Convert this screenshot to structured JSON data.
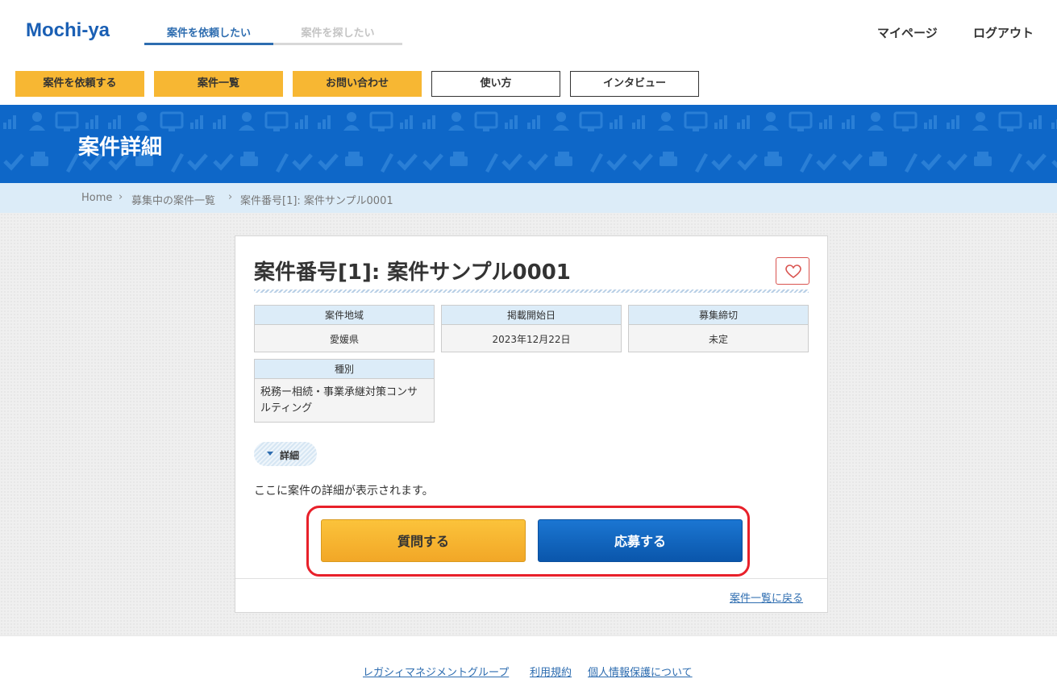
{
  "header": {
    "logo": "Mochi-ya",
    "mode_tabs": [
      {
        "label": "案件を依頼したい",
        "active": true
      },
      {
        "label": "案件を探したい",
        "active": false
      }
    ],
    "mypage": "マイページ",
    "logout": "ログアウト"
  },
  "subnav": [
    {
      "label": "案件を依頼する",
      "style": "yellow"
    },
    {
      "label": "案件一覧",
      "style": "yellow"
    },
    {
      "label": "お問い合わせ",
      "style": "yellow"
    },
    {
      "label": "使い方",
      "style": "outline"
    },
    {
      "label": "インタビュー",
      "style": "outline"
    }
  ],
  "banner": {
    "title": "案件詳細"
  },
  "breadcrumb": {
    "items": [
      "Home",
      "募集中の案件一覧",
      "案件番号[1]: 案件サンプル0001"
    ],
    "separator": "›"
  },
  "project": {
    "title": "案件番号[1]: 案件サンプル0001",
    "favorite_icon": "heart-icon",
    "fields": {
      "region": {
        "label": "案件地域",
        "value": "愛媛県"
      },
      "start_date": {
        "label": "掲載開始日",
        "value": "2023年12月22日"
      },
      "deadline": {
        "label": "募集締切",
        "value": "未定"
      },
      "category": {
        "label": "種別",
        "value_line1": "税務ー相続・事業承継対策コンサ",
        "value_line2": "ルティング"
      }
    },
    "detail_toggle": "詳細",
    "detail_text": "ここに案件の詳細が表示されます。",
    "ask_button": "質問する",
    "apply_button": "応募する",
    "back_link": "案件一覧に戻る"
  },
  "footer": {
    "links": [
      "レガシィマネジメントグループ",
      "利用規約",
      "個人情報保護について"
    ]
  },
  "colors": {
    "brand_blue": "#1a5fb4",
    "banner_blue": "#0e67c8",
    "accent_yellow": "#f7b733",
    "highlight_red": "#e8202a"
  }
}
